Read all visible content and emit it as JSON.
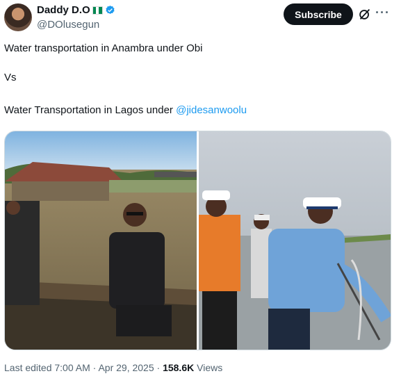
{
  "author": {
    "display_name": "Daddy D.O",
    "handle": "@DOlusegun",
    "verified": true,
    "flag": "nigeria-flag",
    "avatar": "avatar-photo"
  },
  "actions": {
    "subscribe_label": "Subscribe",
    "grok_icon": "grok-icon",
    "more_icon": "more-icon"
  },
  "tweet": {
    "line1": "Water transportation in Anambra under Obi",
    "line2": "Vs",
    "line3_prefix": "Water Transportation in Lagos under ",
    "mention": "@jidesanwoolu"
  },
  "media": {
    "left_photo": "photo-canoe-flooded-area",
    "right_photo": "photo-officials-on-boat"
  },
  "meta": {
    "edited": "Last edited 7:00 AM",
    "separator": "·",
    "date": "Apr 29, 2025",
    "views_count": "158.6K",
    "views_label": "Views"
  },
  "colors": {
    "accent": "#1d9bf0",
    "text": "#0f1419",
    "muted": "#536471",
    "button_bg": "#0f1419"
  }
}
